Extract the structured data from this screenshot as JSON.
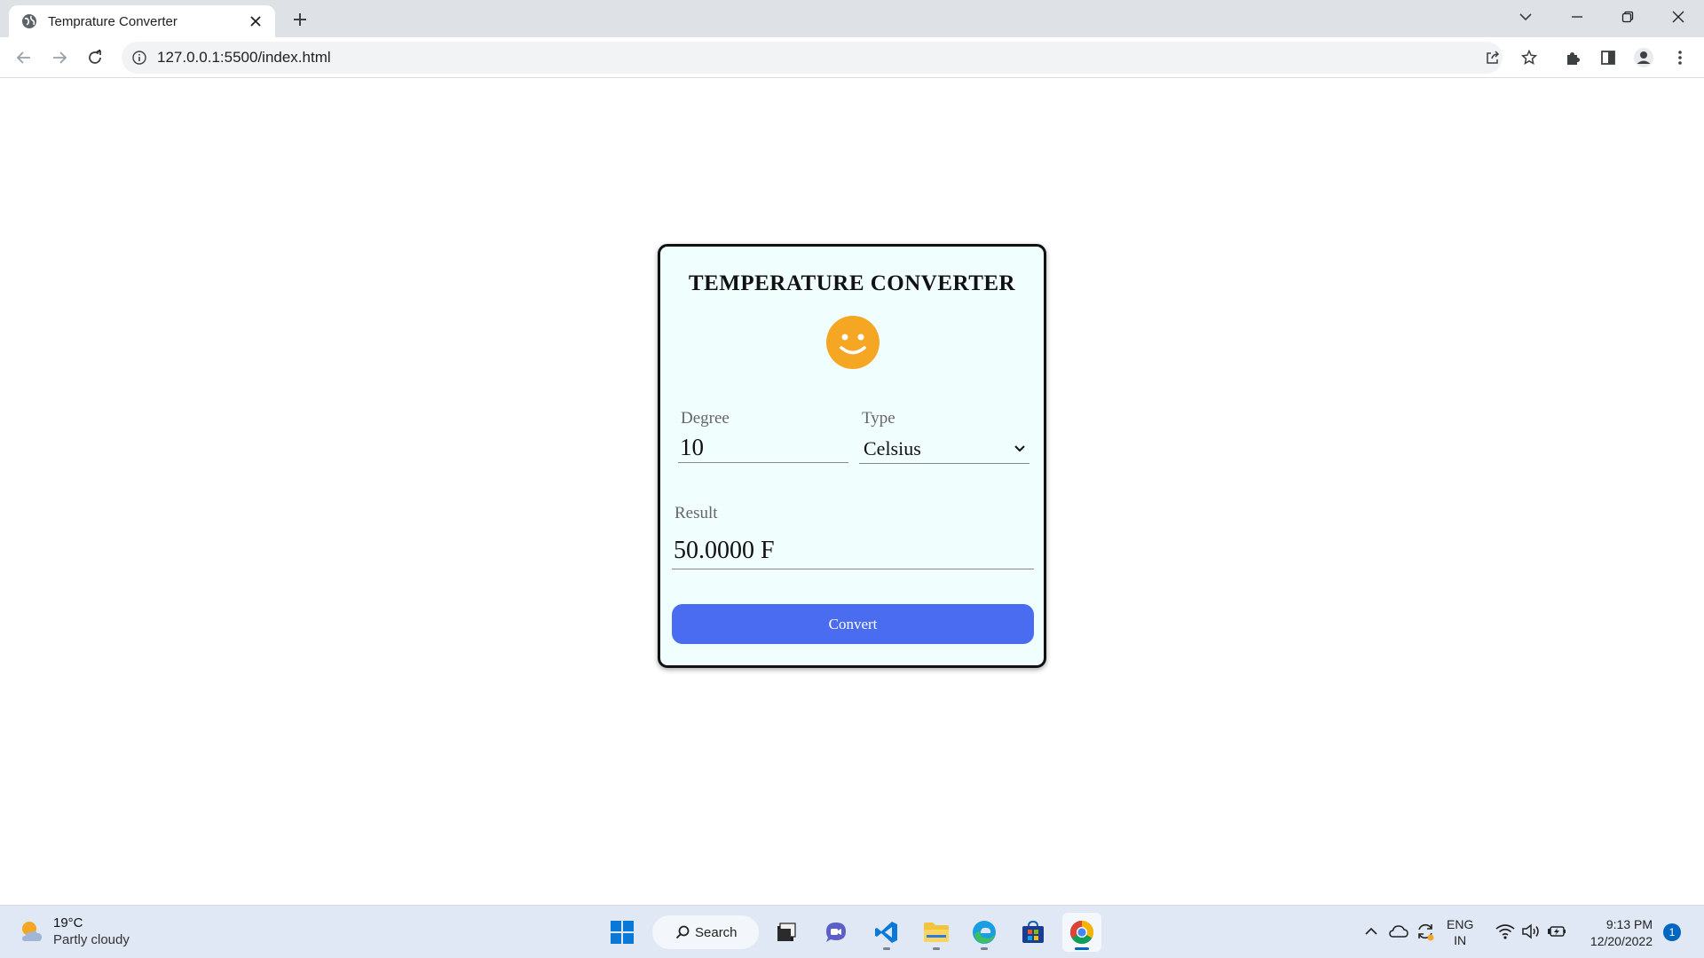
{
  "browser": {
    "tab_title": "Temprature Converter",
    "url": "127.0.0.1:5500/index.html"
  },
  "app": {
    "title": "TEMPERATURE CONVERTER",
    "degree_label": "Degree",
    "degree_value": "10",
    "type_label": "Type",
    "type_selected": "Celsius",
    "result_label": "Result",
    "result_value": "50.0000 F",
    "convert_label": "Convert",
    "accent_color": "#4a6cf0",
    "smiley_color": "#f5a623"
  },
  "taskbar": {
    "weather_temp": "19°C",
    "weather_condition": "Partly cloudy",
    "search_label": "Search",
    "lang_primary": "ENG",
    "lang_secondary": "IN",
    "time": "9:13 PM",
    "date": "12/20/2022",
    "notification_count": "1"
  }
}
